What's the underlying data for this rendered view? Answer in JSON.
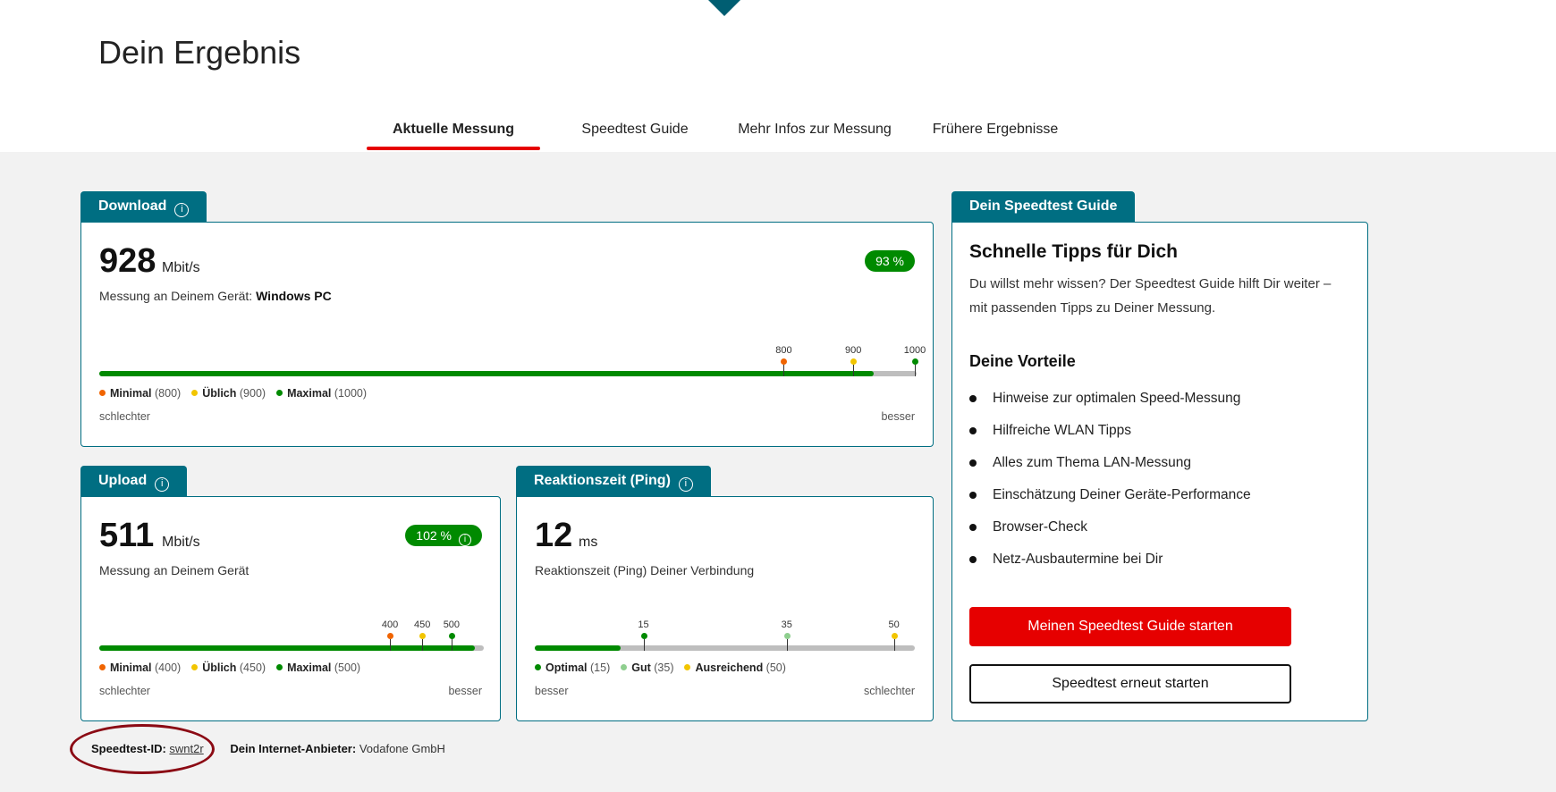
{
  "page": {
    "title": "Dein Ergebnis"
  },
  "tabs": [
    "Aktuelle Messung",
    "Speedtest Guide",
    "Mehr Infos zur Messung",
    "Frühere Ergebnisse"
  ],
  "download": {
    "tab_label": "Download",
    "value": "928",
    "unit": "Mbit/s",
    "subtitle_prefix": "Messung an Deinem Gerät:",
    "device": "Windows PC",
    "percent": "93 %",
    "fill_fraction": 0.947,
    "markers": [
      "800",
      "900",
      "1000"
    ],
    "legend": [
      {
        "label": "Minimal",
        "paren": "(800)",
        "color": "#f06400"
      },
      {
        "label": "Üblich",
        "paren": "(900)",
        "color": "#f2c500"
      },
      {
        "label": "Maximal",
        "paren": "(1000)",
        "color": "#008a00"
      }
    ],
    "scale_left": "schlechter",
    "scale_right": "besser"
  },
  "upload": {
    "tab_label": "Upload",
    "value": "511",
    "unit": "Mbit/s",
    "subtitle": "Messung an Deinem Gerät",
    "percent": "102 %",
    "fill_fraction": 0.976,
    "markers": [
      "400",
      "450",
      "500"
    ],
    "legend": [
      {
        "label": "Minimal",
        "paren": "(400)",
        "color": "#f06400"
      },
      {
        "label": "Üblich",
        "paren": "(450)",
        "color": "#f2c500"
      },
      {
        "label": "Maximal",
        "paren": "(500)",
        "color": "#008a00"
      }
    ],
    "scale_left": "schlechter",
    "scale_right": "besser"
  },
  "ping": {
    "tab_label": "Reaktionszeit (Ping)",
    "value": "12",
    "unit": "ms",
    "subtitle": "Reaktionszeit (Ping) Deiner Verbindung",
    "fill_fraction": 0.225,
    "markers": [
      "15",
      "35",
      "50"
    ],
    "legend": [
      {
        "label": "Optimal",
        "paren": "(15)",
        "color": "#008a00"
      },
      {
        "label": "Gut",
        "paren": "(35)",
        "color": "#8fcf8f"
      },
      {
        "label": "Ausreichend",
        "paren": "(50)",
        "color": "#f2c500"
      }
    ],
    "scale_left": "besser",
    "scale_right": "schlechter"
  },
  "guide": {
    "tab_label": "Dein Speedtest Guide",
    "heading": "Schnelle Tipps für Dich",
    "text": "Du willst mehr wissen? Der Speedtest Guide hilft Dir weiter – mit passenden Tipps zu Deiner Messung.",
    "benefits_heading": "Deine Vorteile",
    "benefits": [
      "Hinweise zur optimalen Speed-Messung",
      "Hilfreiche WLAN Tipps",
      "Alles zum Thema LAN-Messung",
      "Einschätzung Deiner Geräte-Performance",
      "Browser-Check",
      "Netz-Ausbautermine bei Dir"
    ],
    "primary_button": "Meinen Speedtest Guide starten",
    "secondary_button": "Speedtest erneut starten"
  },
  "footer": {
    "id_label": "Speedtest-ID:",
    "id_value": "swnt2r",
    "provider_label": "Dein Internet-Anbieter:",
    "provider_value": "Vodafone GmbH"
  },
  "colors": {
    "accent": "#e60000",
    "teal": "#006e82",
    "green": "#008a00",
    "annotation": "#8b0a14"
  },
  "icons": {
    "info": "info-icon",
    "bullet": "bullet-dot"
  }
}
